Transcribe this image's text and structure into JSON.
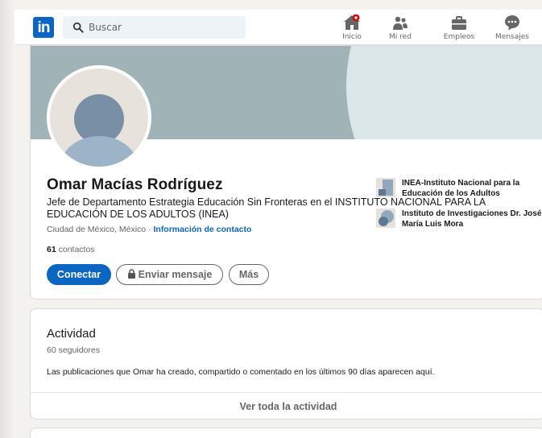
{
  "nav": {
    "logo_text": "in",
    "search_placeholder": "Buscar",
    "items": [
      {
        "label": "Inicio",
        "icon": "home-icon"
      },
      {
        "label": "Mi red",
        "icon": "people-icon"
      },
      {
        "label": "Empleos",
        "icon": "briefcase-icon"
      },
      {
        "label": "Mensajes",
        "icon": "messaging-icon"
      }
    ],
    "notification_color": "#cc1016"
  },
  "profile": {
    "name": "Omar Macías Rodríguez",
    "headline": "Jefe de Departamento Estrategia Educación Sin Fronteras en el INSTITUTO NACIONAL PARA LA EDUCACIÓN DE LOS ADULTOS (INEA)",
    "location": "Ciudad de México, México",
    "location_separator": " · ",
    "contact_info": "Información de contacto",
    "connections_count": "61",
    "connections_label": "contactos",
    "buttons": {
      "connect": "Conectar",
      "message": "Enviar mensaje",
      "more": "Más"
    },
    "organizations": [
      {
        "name": "INEA-Instituto Nacional para la Educación de los Adultos"
      },
      {
        "name": "Instituto de Investigaciones Dr. José María Luis Mora"
      }
    ]
  },
  "activity": {
    "title": "Actividad",
    "followers": "60 seguidores",
    "description": "Las publicaciones que Omar ha creado, compartido o comentado en los últimos 90 días aparecen aquí.",
    "see_all": "Ver toda la actividad"
  },
  "colors": {
    "brand": "#0a66c2",
    "background": "#f3f2ef",
    "banner": "#a0b4b7"
  }
}
